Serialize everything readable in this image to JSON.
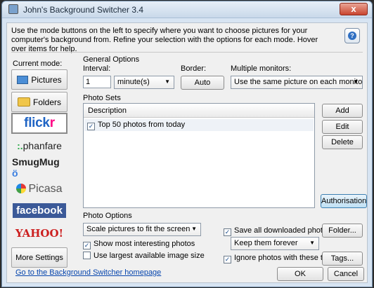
{
  "window": {
    "title": "John's Background Switcher 3.4",
    "close_label": "x"
  },
  "instructions": "Use the mode buttons on the left to specify where you want to choose pictures for your computer's background from. Refine your selection with the options for each mode. Hover over items for help.",
  "help_icon": "help-icon",
  "sidebar": {
    "label": "Current mode:",
    "modes": [
      {
        "label": "Pictures",
        "icon": "picture-icon"
      },
      {
        "label": "Folders",
        "icon": "folder-icon"
      },
      {
        "label": "flick",
        "label_accent": "r"
      },
      {
        "label": "phanfare",
        "mark": ":."
      },
      {
        "label": "SmugMug",
        "mark": "ö"
      },
      {
        "label": "Picasa"
      },
      {
        "label": "facebook"
      },
      {
        "label": "YAHOO!"
      }
    ],
    "more_settings": "More Settings"
  },
  "general_options": {
    "title": "General Options",
    "interval_label": "Interval:",
    "interval_value": "1",
    "interval_unit": "minute(s)",
    "border_label": "Border:",
    "border_value": "Auto",
    "monitors_label": "Multiple monitors:",
    "monitors_value": "Use the same picture on each monitor"
  },
  "photo_sets": {
    "title": "Photo Sets",
    "column_header": "Description",
    "rows": [
      {
        "label": "Top 50 photos from today",
        "checked": true
      }
    ],
    "buttons": {
      "add": "Add",
      "edit": "Edit",
      "delete": "Delete",
      "authorisation": "Authorisation"
    }
  },
  "photo_options": {
    "title": "Photo Options",
    "scale_value": "Scale pictures to fit the screen",
    "show_interesting": {
      "label": "Show most interesting photos",
      "checked": true
    },
    "use_largest": {
      "label": "Use largest available image size",
      "checked": false
    },
    "save_downloaded": {
      "label": "Save all downloaded photos",
      "checked": true
    },
    "folder_button": "Folder...",
    "keep_value": "Keep them forever",
    "ignore_tags": {
      "label": "Ignore photos with these tags:",
      "checked": true
    },
    "tags_button": "Tags..."
  },
  "footer": {
    "homepage_link": "Go to the Background Switcher homepage",
    "ok": "OK",
    "cancel": "Cancel"
  },
  "check_mark": "✓",
  "arrow_glyph": "▼"
}
